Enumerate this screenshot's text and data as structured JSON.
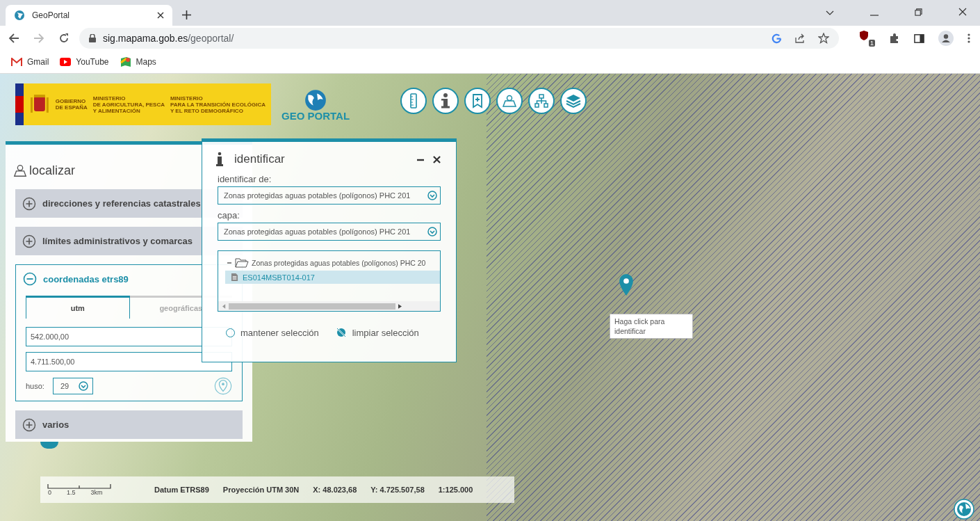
{
  "browser": {
    "tab": {
      "title": "GeoPortal",
      "selected": true
    },
    "url_host": "sig.mapama.gob.es",
    "url_path": "/geoportal/",
    "bookmarks": [
      {
        "label": "Gmail",
        "kind": "gmail"
      },
      {
        "label": "YouTube",
        "kind": "youtube"
      },
      {
        "label": "Maps",
        "kind": "maps"
      }
    ],
    "extension_badge": "1"
  },
  "header": {
    "banner": [
      "GOBIERNO\nDE ESPAÑA",
      "MINISTERIO\nDE AGRICULTURA, PESCA\nY ALIMENTACIÓN",
      "MINISTERIO\nPARA LA TRANSICIÓN ECOLÓGICA\nY EL RETO DEMOGRÁFICO"
    ],
    "logo": "GEO PORTAL",
    "tools": [
      {
        "kind": "ruler"
      },
      {
        "kind": "info"
      },
      {
        "kind": "bookmark"
      },
      {
        "kind": "locate"
      },
      {
        "kind": "tree"
      },
      {
        "kind": "layers"
      }
    ]
  },
  "localizar": {
    "title": "localizar",
    "sections": [
      {
        "label": "direcciones y referencias catastrales",
        "expanded": false
      },
      {
        "label": "límites administrativos y comarcas",
        "expanded": false
      },
      {
        "label": "coordenadas etrs89",
        "expanded": true,
        "tabs": [
          {
            "label": "utm",
            "selected": true
          },
          {
            "label": "geográficas",
            "selected": false
          }
        ],
        "fields": [
          "542.000,00",
          "4.711.500,00"
        ],
        "huso_label": "huso:",
        "huso_value": "29"
      },
      {
        "label": "varios",
        "expanded": false
      }
    ]
  },
  "identificar": {
    "title": "identificar",
    "from_label": "identificar de:",
    "from_value": "Zonas protegidas aguas potables (polígonos) PHC 201",
    "layer_label": "capa:",
    "layer_value": "Zonas protegidas aguas potables (polígonos) PHC 201",
    "tree": [
      {
        "label": "Zonas protegidas aguas potables (polígonos) PHC 20",
        "expanded": true,
        "children": [
          {
            "label": "ES014MSBT014-017",
            "selected": true
          }
        ]
      }
    ],
    "keep_selection": {
      "label": "mantener selección",
      "checked": false
    },
    "clear_selection": "limpiar selección"
  },
  "map": {
    "tooltip": "Haga click para\nidentificar"
  },
  "status_bar": {
    "scale_ticks": [
      "0",
      "1.5",
      "3km"
    ],
    "datum": "Datum ETRS89",
    "projection": "Proyección UTM 30N",
    "x": "X: 48.023,68",
    "y": "Y: 4.725.507,58",
    "scale": "1:125.000"
  }
}
